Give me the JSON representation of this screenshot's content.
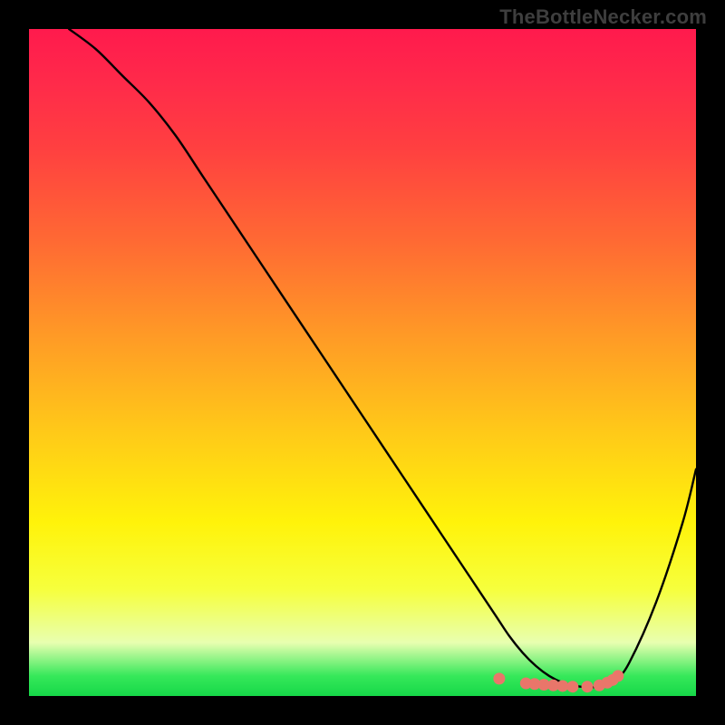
{
  "watermark": "TheBottleNecker.com",
  "chart_data": {
    "type": "line",
    "title": "",
    "xlabel": "",
    "ylabel": "",
    "xlim": [
      0,
      100
    ],
    "ylim": [
      0,
      100
    ],
    "legend": false,
    "grid": false,
    "annotations": [],
    "series": [
      {
        "name": "curve",
        "color": "#000000",
        "x": [
          6,
          10,
          14,
          18,
          22,
          26,
          30,
          34,
          38,
          42,
          46,
          50,
          54,
          58,
          62,
          66,
          70,
          72,
          74,
          76,
          78,
          80,
          82,
          84,
          86,
          88,
          90,
          94,
          98,
          100
        ],
        "y": [
          100,
          97,
          93,
          89,
          84,
          78,
          72,
          66,
          60,
          54,
          48,
          42,
          36,
          30,
          24,
          18,
          12,
          9,
          6.5,
          4.5,
          3,
          2,
          1.5,
          1.3,
          1.5,
          2.5,
          5,
          14,
          26,
          34
        ]
      },
      {
        "name": "markers",
        "type": "scatter",
        "color": "#e9766a",
        "x": [
          70.5,
          74.5,
          75.8,
          77.2,
          78.6,
          80.0,
          81.5,
          83.7,
          85.5,
          86.7,
          87.5,
          88.3
        ],
        "y": [
          2.6,
          1.9,
          1.8,
          1.7,
          1.6,
          1.5,
          1.4,
          1.4,
          1.6,
          2.0,
          2.4,
          3.0
        ]
      }
    ],
    "background": {
      "type": "vertical-gradient",
      "stops": [
        {
          "pos": 0.0,
          "value": 100,
          "color": "#ff1a4d"
        },
        {
          "pos": 0.18,
          "value": 82,
          "color": "#ff4040"
        },
        {
          "pos": 0.46,
          "value": 54,
          "color": "#ff9a26"
        },
        {
          "pos": 0.74,
          "value": 26,
          "color": "#fff30a"
        },
        {
          "pos": 0.92,
          "value": 8,
          "color": "#e8ffb0"
        },
        {
          "pos": 1.0,
          "value": 0,
          "color": "#16d848"
        }
      ]
    }
  }
}
